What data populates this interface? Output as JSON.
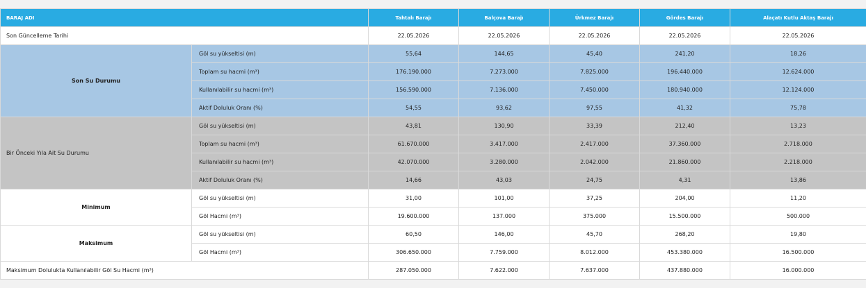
{
  "header": {
    "col0": "BARAJ ADI",
    "dams": [
      "Tahtalı Barajı",
      "Balçova Barajı",
      "Ürkmez Barajı",
      "Gördes Barajı",
      "Alaçatı Kutlu Aktaş Barajı"
    ]
  },
  "update": {
    "label": "Son Güncelleme Tarihi",
    "values": [
      "22.05.2026",
      "22.05.2026",
      "22.05.2026",
      "22.05.2026",
      "22.05.2026"
    ]
  },
  "current": {
    "title": "Son Su Durumu",
    "rows": [
      {
        "label": "Göl su yükseltisi (m)",
        "values": [
          "55,64",
          "144,65",
          "45,40",
          "241,20",
          "18,26"
        ]
      },
      {
        "label": "Toplam su hacmi (m³)",
        "values": [
          "176.190.000",
          "7.273.000",
          "7.825.000",
          "196.440.000",
          "12.624.000"
        ]
      },
      {
        "label": "Kullanılabilir su hacmi (m³)",
        "values": [
          "156.590.000",
          "7.136.000",
          "7.450.000",
          "180.940.000",
          "12.124.000"
        ]
      },
      {
        "label": "Aktif Doluluk Oranı (%)",
        "values": [
          "54,55",
          "93,62",
          "97,55",
          "41,32",
          "75,78"
        ]
      }
    ]
  },
  "previous": {
    "title": "Bir Önceki Yıla Ait Su Durumu",
    "rows": [
      {
        "label": "Göl su yükseltisi (m)",
        "values": [
          "43,81",
          "130,90",
          "33,39",
          "212,40",
          "13,23"
        ]
      },
      {
        "label": "Toplam su hacmi (m³)",
        "values": [
          "61.670.000",
          "3.417.000",
          "2.417.000",
          "37.360.000",
          "2.718.000"
        ]
      },
      {
        "label": "Kullanılabilir su hacmi (m³)",
        "values": [
          "42.070.000",
          "3.280.000",
          "2.042.000",
          "21.860.000",
          "2.218.000"
        ]
      },
      {
        "label": "Aktif Doluluk Oranı (%)",
        "values": [
          "14,66",
          "43,03",
          "24,75",
          "4,31",
          "13,86"
        ]
      }
    ]
  },
  "minimum": {
    "title": "Minimum",
    "rows": [
      {
        "label": "Göl su yükseltisi (m)",
        "values": [
          "31,00",
          "101,00",
          "37,25",
          "204,00",
          "11,20"
        ]
      },
      {
        "label": "Göl Hacmi (m³)",
        "values": [
          "19.600.000",
          "137.000",
          "375.000",
          "15.500.000",
          "500.000"
        ]
      }
    ]
  },
  "maximum": {
    "title": "Maksimum",
    "rows": [
      {
        "label": "Göl su yükseltisi (m)",
        "values": [
          "60,50",
          "146,00",
          "45,70",
          "268,20",
          "19,80"
        ]
      },
      {
        "label": "Göl Hacmi (m³)",
        "values": [
          "306.650.000",
          "7.759.000",
          "8.012.000",
          "453.380.000",
          "16.500.000"
        ]
      }
    ]
  },
  "maxusable": {
    "label": "Maksimum Dolulukta Kullanılabilir Göl Su Hacmi (m³)",
    "values": [
      "287.050.000",
      "7.622.000",
      "7.637.000",
      "437.880.000",
      "16.000.000"
    ]
  }
}
